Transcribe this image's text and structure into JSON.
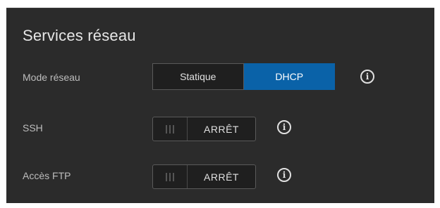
{
  "panel": {
    "title": "Services réseau"
  },
  "network_mode": {
    "label": "Mode réseau",
    "options": [
      "Statique",
      "DHCP"
    ],
    "selected": "DHCP",
    "info_icon": "info-icon"
  },
  "ssh": {
    "label": "SSH",
    "state": "ARRÊT",
    "info_icon": "info-icon"
  },
  "ftp": {
    "label": "Accès FTP",
    "state": "ARRÊT",
    "info_icon": "info-icon"
  },
  "colors": {
    "panel_bg": "#2b2b2b",
    "accent": "#0a62a8"
  }
}
